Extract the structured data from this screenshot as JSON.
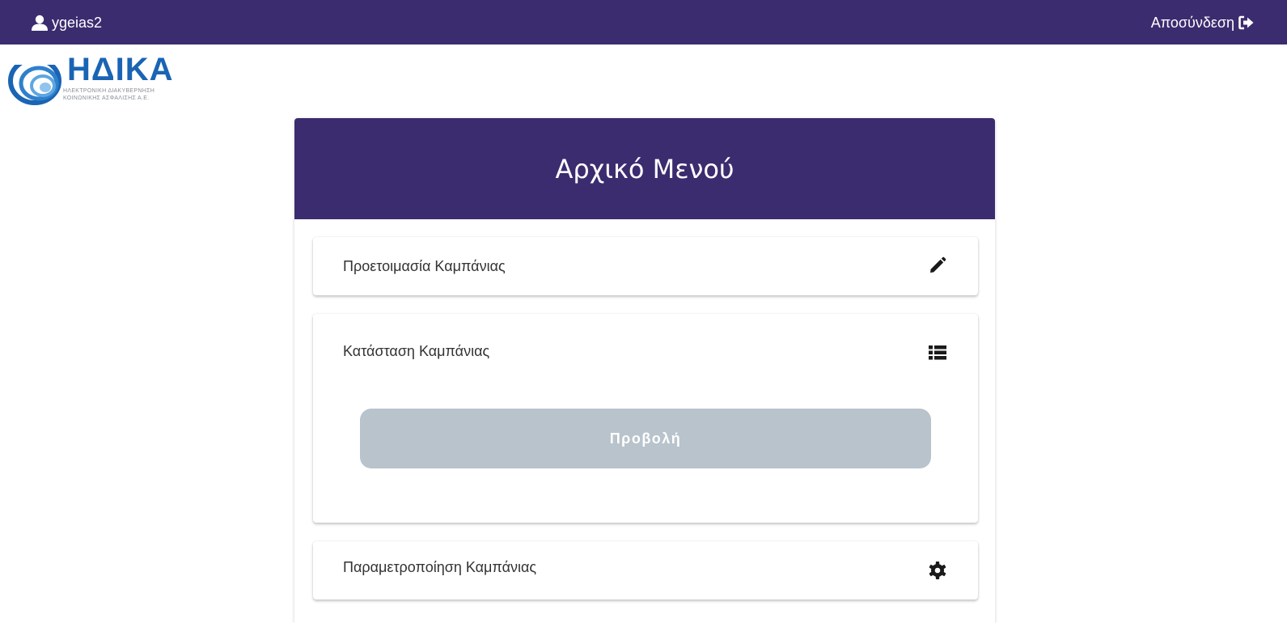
{
  "topbar": {
    "username": "ygeias2",
    "logout_label": "Αποσύνδεση",
    "background_color": "#3b2c6f"
  },
  "logo": {
    "wordmark": "ΗΔΙΚΑ",
    "subtitle_line1": "ΗΛΕΚΤΡΟΝΙΚΗ ΔΙΑΚΥΒΕΡΝΗΣΗ",
    "subtitle_line2": "ΚΟΙΝΩΝΙΚΗΣ ΑΣΦΑΛΙΣΗΣ Α.Ε.",
    "brand_color": "#1a64b4"
  },
  "panel": {
    "title": "Αρχικό Μενού",
    "header_color": "#3b2c6f"
  },
  "cards": [
    {
      "title": "Προετοιμασία Καμπάνιας",
      "icon": "pencil-icon"
    },
    {
      "title": "Κατάσταση Καμπάνιας",
      "icon": "list-icon",
      "button_label": "Προβολή",
      "button_color": "#b8c3cc"
    },
    {
      "title": "Παραμετροποίηση Καμπάνιας",
      "icon": "gear-icon"
    }
  ]
}
